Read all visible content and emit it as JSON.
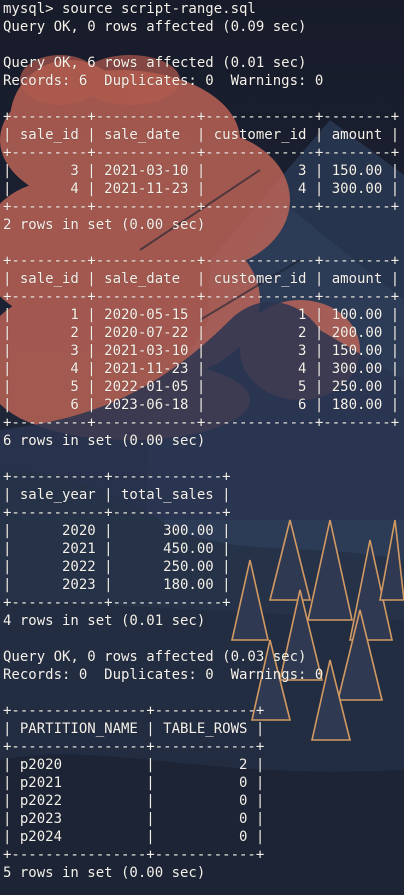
{
  "terminal": {
    "prompt": "mysql>",
    "command": "source script-range.sql"
  },
  "colors": {
    "text": "#f4f1ea",
    "background": "#1e2437",
    "sky_top": "#161b2b",
    "mountain": "#24314a",
    "cloud": "#c86a5a",
    "tree": "#d9a46a"
  },
  "lines": [
    "mysql> source script-range.sql",
    "Query OK, 0 rows affected (0.09 sec)",
    "",
    "Query OK, 6 rows affected (0.01 sec)",
    "Records: 6  Duplicates: 0  Warnings: 0",
    "",
    "+---------+------------+-------------+--------+",
    "| sale_id | sale_date  | customer_id | amount |",
    "+---------+------------+-------------+--------+",
    "|       3 | 2021-03-10 |           3 | 150.00 |",
    "|       4 | 2021-11-23 |           4 | 300.00 |",
    "+---------+------------+-------------+--------+",
    "2 rows in set (0.00 sec)",
    "",
    "+---------+------------+-------------+--------+",
    "| sale_id | sale_date  | customer_id | amount |",
    "+---------+------------+-------------+--------+",
    "|       1 | 2020-05-15 |           1 | 100.00 |",
    "|       2 | 2020-07-22 |           2 | 200.00 |",
    "|       3 | 2021-03-10 |           3 | 150.00 |",
    "|       4 | 2021-11-23 |           4 | 300.00 |",
    "|       5 | 2022-01-05 |           5 | 250.00 |",
    "|       6 | 2023-06-18 |           6 | 180.00 |",
    "+---------+------------+-------------+--------+",
    "6 rows in set (0.00 sec)",
    "",
    "+-----------+-------------+",
    "| sale_year | total_sales |",
    "+-----------+-------------+",
    "|      2020 |      300.00 |",
    "|      2021 |      450.00 |",
    "|      2022 |      250.00 |",
    "|      2023 |      180.00 |",
    "+-----------+-------------+",
    "4 rows in set (0.01 sec)",
    "",
    "Query OK, 0 rows affected (0.03 sec)",
    "Records: 0  Duplicates: 0  Warnings: 0",
    "",
    "+----------------+------------+",
    "| PARTITION_NAME | TABLE_ROWS |",
    "+----------------+------------+",
    "| p2020          |          2 |",
    "| p2021          |          0 |",
    "| p2022          |          0 |",
    "| p2023          |          0 |",
    "| p2024          |          0 |",
    "+----------------+------------+",
    "5 rows in set (0.00 sec)"
  ]
}
